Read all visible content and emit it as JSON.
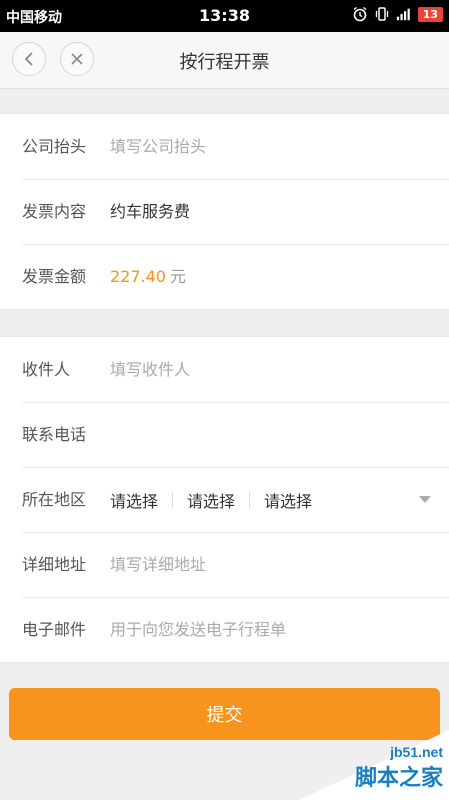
{
  "statusbar": {
    "carrier": "中国移动",
    "time": "13:38",
    "battery": "13"
  },
  "navbar": {
    "title": "按行程开票"
  },
  "invoice": {
    "rows": [
      {
        "label": "公司抬头",
        "placeholder": "填写公司抬头"
      },
      {
        "label": "发票内容",
        "value": "约车服务费"
      },
      {
        "label": "发票金额",
        "amount": "227.40",
        "unit": "元"
      }
    ]
  },
  "recipient": {
    "rows": [
      {
        "label": "收件人",
        "placeholder": "填写收件人"
      },
      {
        "label": "联系电话",
        "value": ""
      },
      {
        "label": "所在地区",
        "selects": [
          "请选择",
          "请选择",
          "请选择"
        ]
      },
      {
        "label": "详细地址",
        "placeholder": "填写详细地址"
      },
      {
        "label": "电子邮件",
        "placeholder": "用于向您发送电子行程单"
      }
    ]
  },
  "submit_label": "提交",
  "watermark": {
    "top": "jb51.net",
    "bottom": "脚本之家"
  },
  "colors": {
    "accent": "#f7941d",
    "background": "#efeff0"
  }
}
